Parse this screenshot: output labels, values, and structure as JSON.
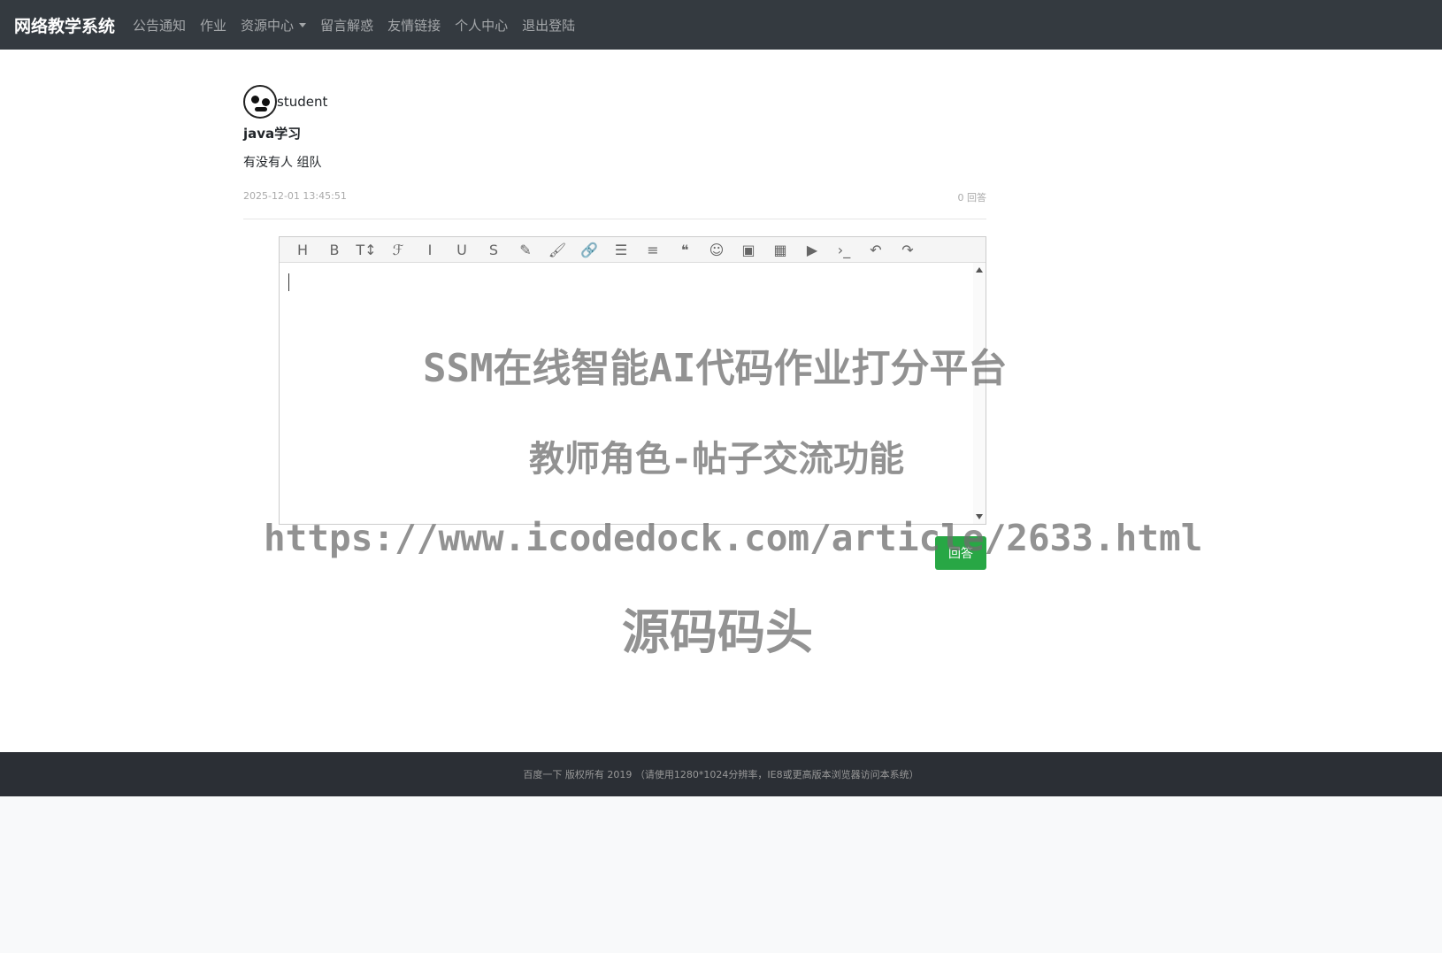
{
  "navbar": {
    "brand": "网络教学系统",
    "items": [
      "公告通知",
      "作业",
      "资源中心",
      "留言解惑",
      "友情链接",
      "个人中心",
      "退出登陆"
    ]
  },
  "post": {
    "author": "student",
    "title": "java学习",
    "content": "有没有人 组队",
    "timestamp": "2025-12-01 13:45:51",
    "answers": "0 回答"
  },
  "editor": {
    "tools": [
      {
        "icon": "heading-icon",
        "glyph": "H"
      },
      {
        "icon": "bold-icon",
        "glyph": "B"
      },
      {
        "icon": "font-size-icon",
        "glyph": "T↕"
      },
      {
        "icon": "font-family-icon",
        "glyph": "ℱ"
      },
      {
        "icon": "italic-icon",
        "glyph": "I"
      },
      {
        "icon": "underline-icon",
        "glyph": "U"
      },
      {
        "icon": "strikethrough-icon",
        "glyph": "S"
      },
      {
        "icon": "font-color-icon",
        "glyph": "✎"
      },
      {
        "icon": "background-color-icon",
        "glyph": "🖌"
      },
      {
        "icon": "link-icon",
        "glyph": "🔗"
      },
      {
        "icon": "list-icon",
        "glyph": "☰"
      },
      {
        "icon": "align-icon",
        "glyph": "≡"
      },
      {
        "icon": "quote-icon",
        "glyph": "❝"
      },
      {
        "icon": "emoticon-icon",
        "glyph": "☺"
      },
      {
        "icon": "image-icon",
        "glyph": "▣"
      },
      {
        "icon": "table-icon",
        "glyph": "▦"
      },
      {
        "icon": "video-icon",
        "glyph": "▶"
      },
      {
        "icon": "code-icon",
        "glyph": "›_"
      },
      {
        "icon": "undo-icon",
        "glyph": "↶"
      },
      {
        "icon": "redo-icon",
        "glyph": "↷"
      }
    ]
  },
  "answer_button": "回答",
  "watermark": {
    "line1": "SSM在线智能AI代码作业打分平台",
    "line2": "教师角色-帖子交流功能",
    "line3": "https://www.icodedock.com/article/2633.html",
    "line4": "源码码头"
  },
  "footer": {
    "text": "百度一下 版权所有 2019 （请使用1280*1024分辨率，IE8或更高版本浏览器访问本系统）"
  },
  "colors": {
    "navbar": "#343a40",
    "footer": "#2b2f35",
    "button": "#28a745"
  }
}
